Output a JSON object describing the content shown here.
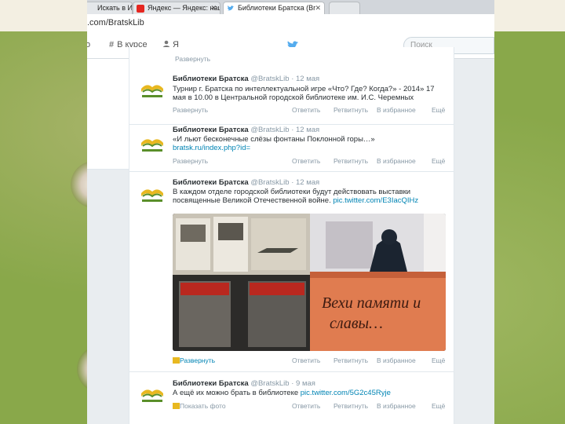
{
  "browser": {
    "tabs": [
      {
        "label": "Искать в Интернете"
      },
      {
        "label": "Яндекс — Яндекс: нашлось"
      },
      {
        "label": "Библиотеки Братска (Br"
      }
    ],
    "url": ".com/BratskLib"
  },
  "twitter_nav": {
    "discover": "В курсе",
    "me": "Я",
    "search_placeholder": "Поиск"
  },
  "top_action": "Развернуть",
  "tweets": [
    {
      "author": "Библиотеки Братска",
      "handle": "@BratskLib · 12 мая",
      "text": "Турнир г. Братска по интеллектуальной игре «Что? Где? Когда?» - 2014» 17 мая в 10.00 в Центральной городской библиотеке им. И.С. Черемных",
      "link": "",
      "expand": "Развернуть"
    },
    {
      "author": "Библиотеки Братска",
      "handle": "@BratskLib · 12 мая",
      "text": "«И льют бесконечные слёзы фонтаны Поклонной горы…»",
      "link": "bratsk.ru/index.php?id=",
      "expand": "Развернуть"
    },
    {
      "author": "Библиотеки Братска",
      "handle": "@BratskLib · 12 мая",
      "text": "В каждом отделе городской библиотеки будут действовать выставки посвященные Великой Отечественной войне.",
      "link": "pic.twitter.com/E3IacQIHz",
      "expand": "Развернуть",
      "image_caption_line1": "Вехи памяти и",
      "image_caption_line2": "славы…"
    },
    {
      "author": "Библиотеки Братска",
      "handle": "@BratskLib · 9 мая",
      "text": "А ещё их можно брать в библиотеке",
      "link": "pic.twitter.com/5G2c45Ryje",
      "expand": "Показать фото"
    }
  ],
  "actions": {
    "reply": "Ответить",
    "retweet": "Ретвитнуть",
    "favorite": "В избранное",
    "more": "Ещё"
  },
  "colors": {
    "link": "#0084b4",
    "muted": "#8899a6",
    "background": "#89a84a"
  }
}
